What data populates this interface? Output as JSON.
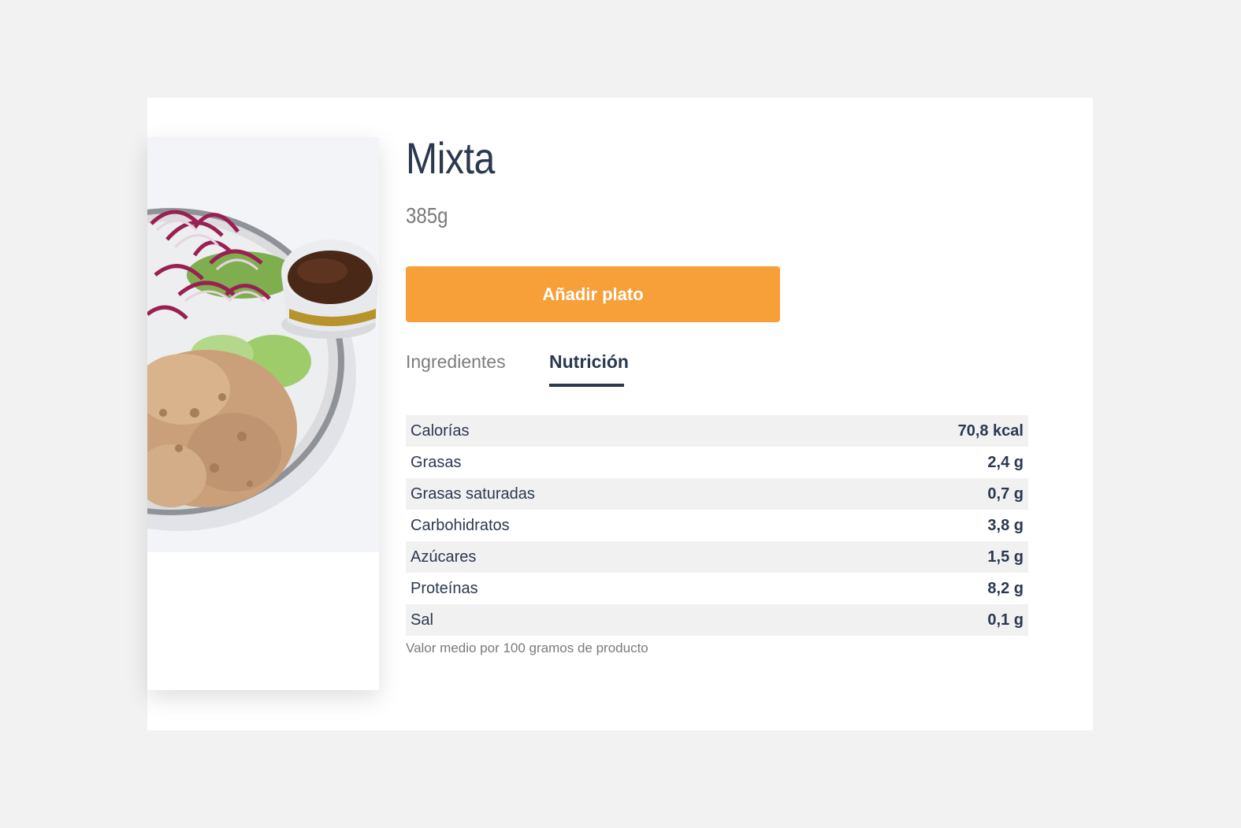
{
  "product": {
    "name": "Mixta",
    "weight": "385g"
  },
  "actions": {
    "add_label": "Añadir plato"
  },
  "tabs": [
    {
      "label": "Ingredientes",
      "active": false
    },
    {
      "label": "Nutrición",
      "active": true
    }
  ],
  "nutrition": {
    "rows": [
      {
        "label": "Calorías",
        "value": "70,8 kcal"
      },
      {
        "label": "Grasas",
        "value": "2,4 g"
      },
      {
        "label": "Grasas saturadas",
        "value": "0,7 g"
      },
      {
        "label": "Carbohidratos",
        "value": "3,8 g"
      },
      {
        "label": "Azúcares",
        "value": "1,5 g"
      },
      {
        "label": "Proteínas",
        "value": "8,2 g"
      },
      {
        "label": "Sal",
        "value": "0,1 g"
      }
    ],
    "footnote": "Valor medio por 100 gramos de producto"
  },
  "colors": {
    "accent": "#f7a03a",
    "text_dark": "#2b3850",
    "text_muted": "#7a7a7a",
    "row_stripe": "#f1f1f1",
    "page_bg": "#f2f2f2"
  }
}
